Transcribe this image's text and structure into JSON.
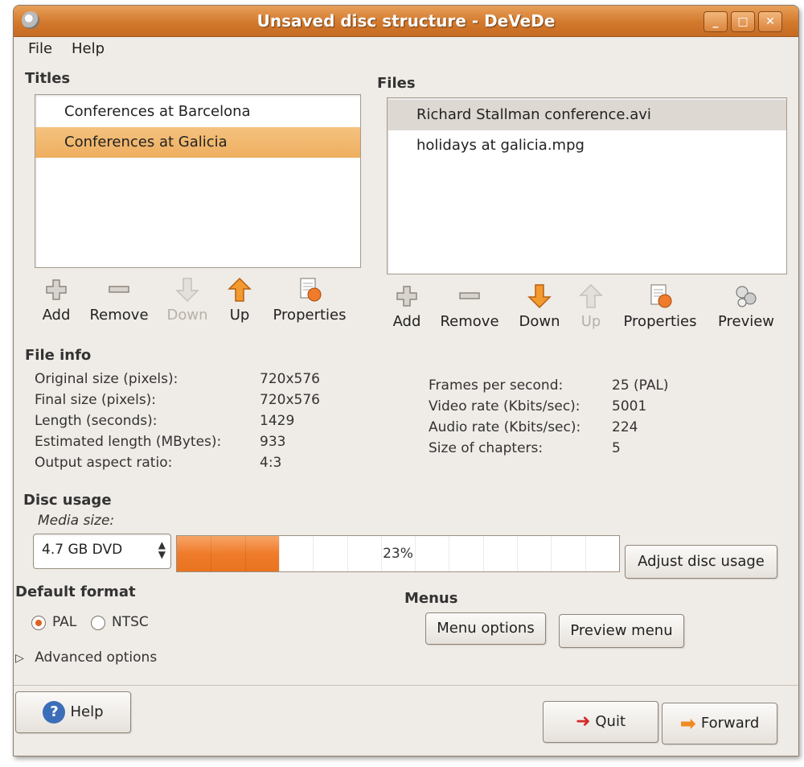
{
  "window": {
    "title": "Unsaved disc structure - DeVeDe"
  },
  "menu": {
    "file": "File",
    "help": "Help"
  },
  "titles": {
    "heading": "Titles",
    "items": [
      "Conferences at Barcelona",
      "Conferences at Galicia"
    ],
    "selected_index": 1,
    "toolbar": {
      "add": "Add",
      "remove": "Remove",
      "down": "Down",
      "up": "Up",
      "properties": "Properties"
    }
  },
  "files": {
    "heading": "Files",
    "items": [
      "Richard Stallman conference.avi",
      "holidays at galicia.mpg"
    ],
    "selected_index": 0,
    "toolbar": {
      "add": "Add",
      "remove": "Remove",
      "down": "Down",
      "up": "Up",
      "properties": "Properties",
      "preview": "Preview"
    }
  },
  "file_info": {
    "heading": "File info",
    "left": [
      {
        "label": "Original size (pixels):",
        "value": "720x576"
      },
      {
        "label": "Final size (pixels):",
        "value": "720x576"
      },
      {
        "label": "Length (seconds):",
        "value": "1429"
      },
      {
        "label": "Estimated length (MBytes):",
        "value": "933"
      },
      {
        "label": "Output aspect ratio:",
        "value": "4:3"
      }
    ],
    "right": [
      {
        "label": "Frames per second:",
        "value": "25 (PAL)"
      },
      {
        "label": "Video rate (Kbits/sec):",
        "value": "5001"
      },
      {
        "label": "Audio rate (Kbits/sec):",
        "value": "224"
      },
      {
        "label": "Size of chapters:",
        "value": "5"
      }
    ]
  },
  "disc_usage": {
    "heading": "Disc usage",
    "media_size_label": "Media size:",
    "media_size_value": "4.7 GB DVD",
    "percent_text": "23%",
    "percent_value": 0.23,
    "adjust_button": "Adjust disc usage"
  },
  "default_format": {
    "heading": "Default format",
    "pal": "PAL",
    "ntsc": "NTSC",
    "selected": "PAL"
  },
  "menus": {
    "heading": "Menus",
    "menu_options": "Menu options",
    "preview_menu": "Preview menu"
  },
  "advanced": {
    "label": "Advanced options"
  },
  "bottom": {
    "help": "Help",
    "quit": "Quit",
    "forward": "Forward"
  },
  "colors": {
    "accent": "#ef7b2b",
    "selection": "#f4c27e",
    "titlebar": "#d2792d"
  }
}
